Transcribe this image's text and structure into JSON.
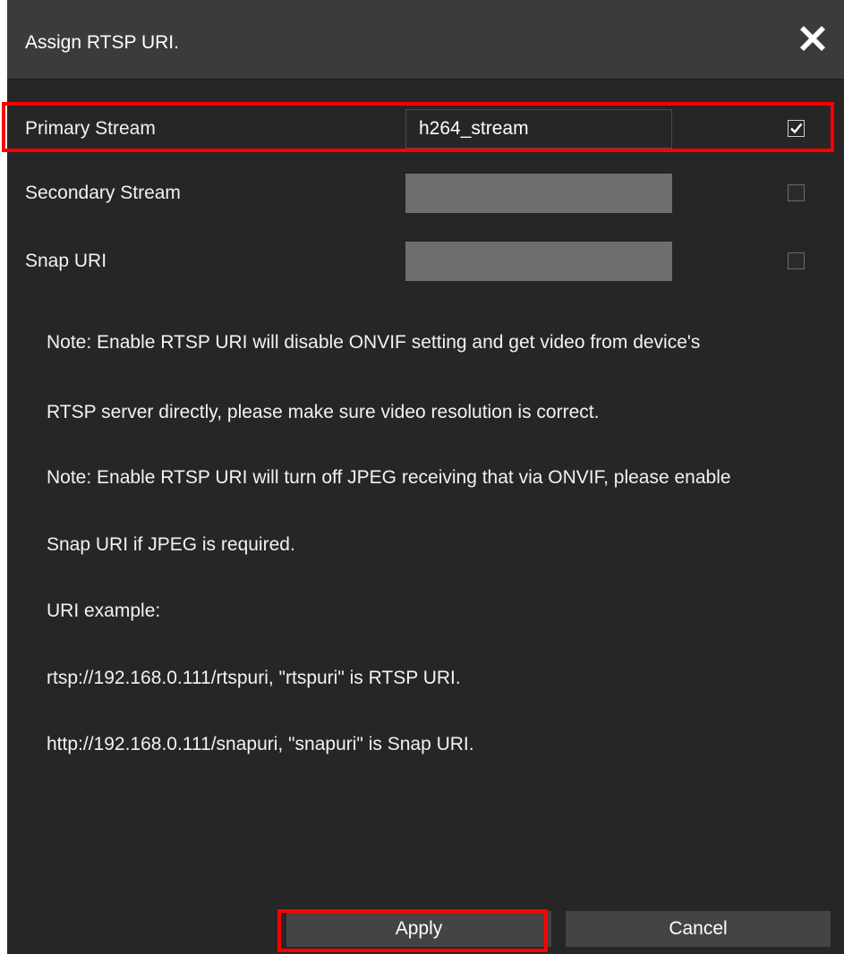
{
  "dialog": {
    "title": "Assign RTSP URI.",
    "close_icon": "close-icon",
    "rows": [
      {
        "label": "Primary Stream",
        "value": "h264_stream",
        "placeholder": "",
        "checked": true
      },
      {
        "label": "Secondary Stream",
        "value": "",
        "placeholder": "",
        "checked": false
      },
      {
        "label": "Snap URI",
        "value": "",
        "placeholder": "",
        "checked": false
      }
    ],
    "notes": [
      "Note: Enable RTSP URI will disable ONVIF setting and get video from device's",
      "RTSP server directly, please make sure video resolution is correct.",
      "Note: Enable RTSP URI will turn off JPEG receiving that via ONVIF, please enable",
      "Snap URI if JPEG is required.",
      "URI example:",
      "rtsp://192.168.0.111/rtspuri, \"rtspuri\" is RTSP URI.",
      "http://192.168.0.111/snapuri, \"snapuri\" is Snap URI."
    ],
    "buttons": {
      "apply_label": "Apply",
      "cancel_label": "Cancel"
    }
  },
  "colors": {
    "background": "#262626",
    "titlebar": "#3b3b3b",
    "highlight": "#ff0000",
    "button": "#444444"
  }
}
